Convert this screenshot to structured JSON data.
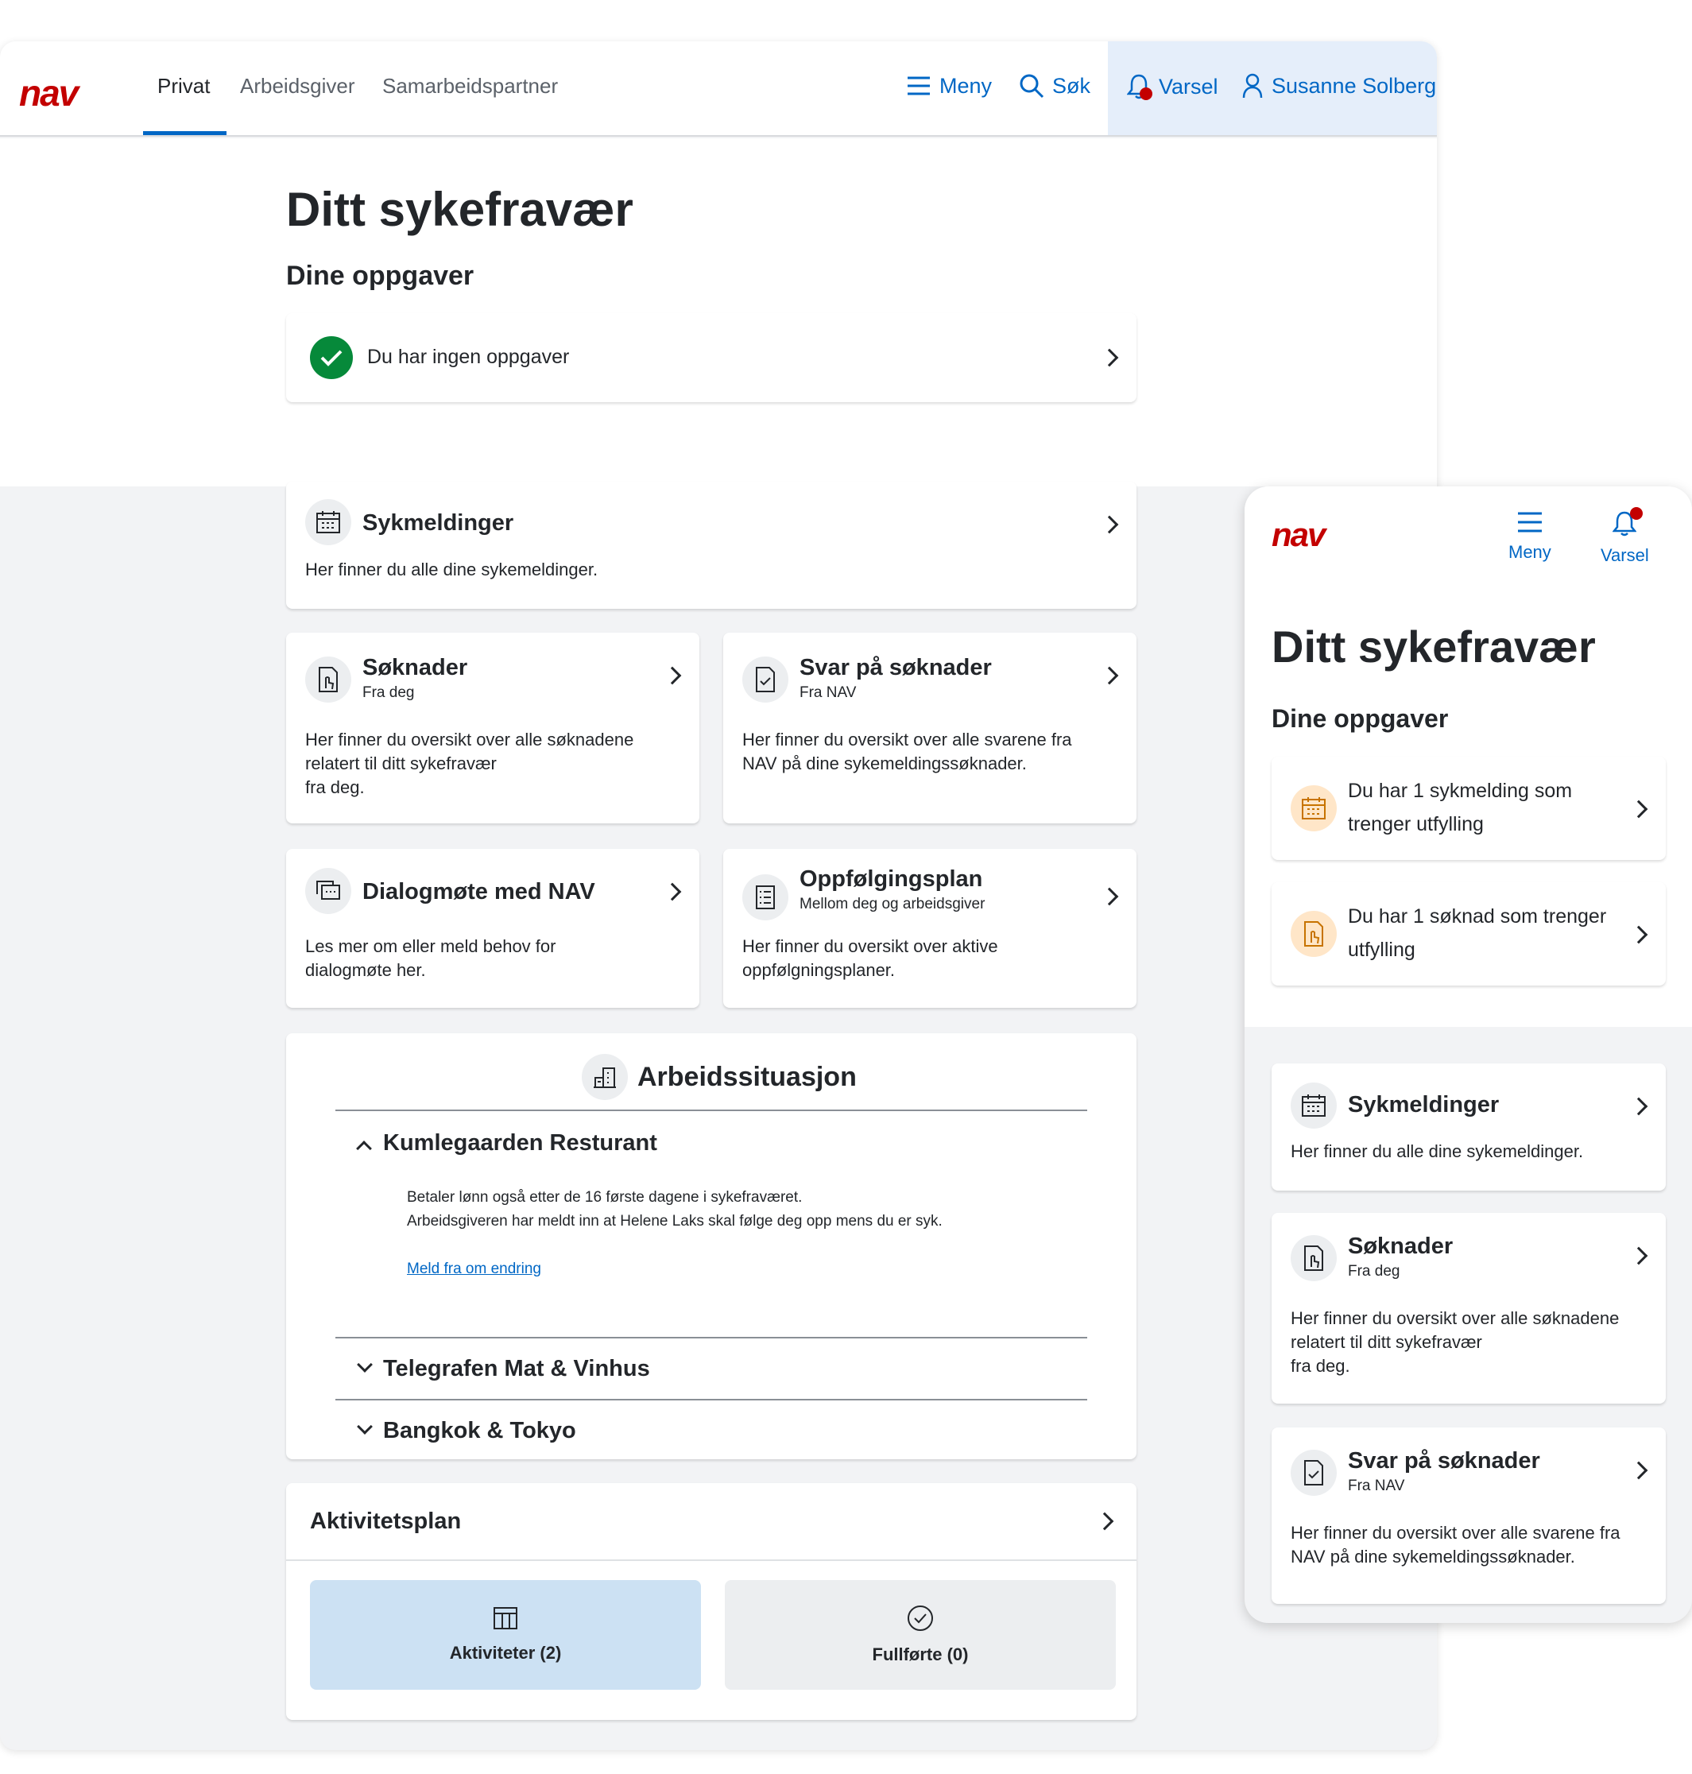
{
  "desktop": {
    "logo": "nav",
    "tabs": [
      {
        "label": "Privat",
        "active": true
      },
      {
        "label": "Arbeidsgiver",
        "active": false
      },
      {
        "label": "Samarbeidspartner",
        "active": false
      }
    ],
    "header_buttons": {
      "menu": "Meny",
      "search": "Søk",
      "notifications": "Varsel",
      "user": "Susanne Solberg"
    },
    "title": "Ditt sykefravær",
    "tasks_heading": "Dine oppgaver",
    "no_tasks": "Du har ingen oppgaver",
    "cards": {
      "sykmeldinger": {
        "title": "Sykmeldinger",
        "text": "Her finner du alle dine sykemeldinger."
      },
      "soknader": {
        "title": "Søknader",
        "sub": "Fra deg",
        "text_lines": [
          "Her finner du oversikt over alle søknadene",
          "relatert til ditt sykefravær",
          "fra deg."
        ]
      },
      "svar": {
        "title": "Svar på søknader",
        "sub": "Fra NAV",
        "text_lines": [
          "Her finner du oversikt over alle svarene fra",
          "NAV på dine sykemeldingssøknader."
        ]
      },
      "dialogmote": {
        "title": "Dialogmøte med NAV",
        "text_lines": [
          "Les mer om eller meld behov for",
          "dialogmøte her."
        ]
      },
      "oppfolging": {
        "title": "Oppfølgingsplan",
        "sub": "Mellom deg og arbeidsgiver",
        "text_lines": [
          "Her finner du oversikt over aktive",
          "oppfølgningsplaner."
        ]
      }
    },
    "work": {
      "title": "Arbeidssituasjon",
      "employers": [
        {
          "name": "Kumlegaarden Resturant",
          "expanded": true
        },
        {
          "name": "Telegrafen Mat & Vinhus",
          "expanded": false
        },
        {
          "name": "Bangkok & Tokyo",
          "expanded": false
        }
      ],
      "details_lines": [
        "Betaler lønn også etter de 16 første dagene i sykefraværet.",
        "Arbeidsgiveren har meldt inn at Helene Laks skal følge deg opp mens du er syk."
      ],
      "change_link": "Meld fra om endring"
    },
    "activity": {
      "title": "Aktivitetsplan",
      "active_label": "Aktiviteter (2)",
      "done_label": "Fullførte (0)"
    }
  },
  "mobile": {
    "logo": "nav",
    "menu": "Meny",
    "notifications": "Varsel",
    "title": "Ditt sykefravær",
    "tasks_heading": "Dine oppgaver",
    "tasks": [
      {
        "lines": [
          "Du har 1 sykmelding som",
          "trenger utfylling"
        ]
      },
      {
        "lines": [
          "Du har 1 søknad  som trenger",
          "utfylling"
        ]
      }
    ],
    "cards": {
      "sykmeldinger": {
        "title": "Sykmeldinger",
        "text": "Her finner du alle dine sykemeldinger."
      },
      "soknader": {
        "title": "Søknader",
        "sub": "Fra deg",
        "text_lines": [
          "Her finner du oversikt over alle søknadene",
          "relatert til ditt sykefravær",
          "fra deg."
        ]
      },
      "svar": {
        "title": "Svar på søknader",
        "sub": "Fra NAV",
        "text_lines": [
          "Her finner du oversikt over alle svarene fra",
          "NAV på dine sykemeldingssøknader."
        ]
      }
    }
  },
  "colors": {
    "brand_red": "#c30000",
    "link_blue": "#0067c5",
    "success_green": "#06893a",
    "selected_button": "#cce1f3",
    "warning_icon_bg": "#ffe6c8"
  }
}
